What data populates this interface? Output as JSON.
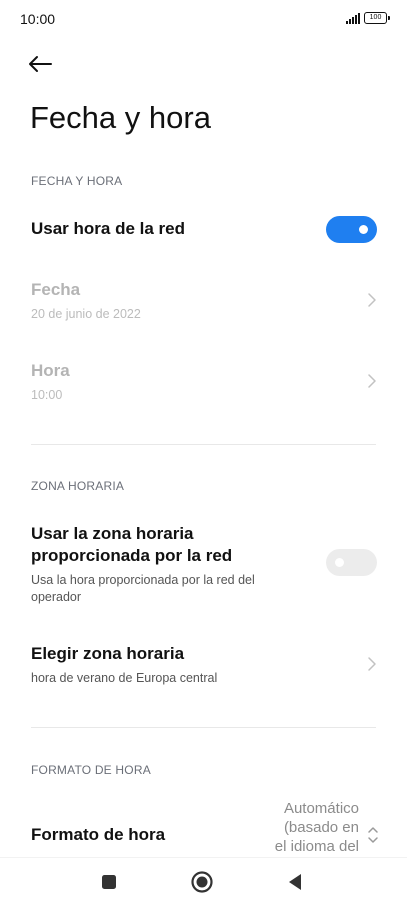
{
  "status_bar": {
    "time": "10:00",
    "battery": "100"
  },
  "page": {
    "title": "Fecha y hora"
  },
  "sections": {
    "date_time": {
      "header": "FECHA Y HORA",
      "network_time": {
        "title": "Usar hora de la red",
        "enabled": true
      },
      "date": {
        "title": "Fecha",
        "value": "20 de junio de 2022"
      },
      "time": {
        "title": "Hora",
        "value": "10:00"
      }
    },
    "time_zone": {
      "header": "ZONA HORARIA",
      "network_zone": {
        "title_line1": "Usar la zona horaria",
        "title_line2": "proporcionada por la red",
        "subtitle_line1": "Usa la hora proporcionada por la red del",
        "subtitle_line2": "operador",
        "enabled": false
      },
      "choose_zone": {
        "title": "Elegir zona horaria",
        "value": "hora de verano de Europa central"
      }
    },
    "time_format": {
      "header": "FORMATO DE HORA",
      "format": {
        "title": "Formato de hora",
        "value_line1": "Automático",
        "value_line2": "(basado en",
        "value_line3": "el idioma del"
      }
    }
  },
  "colors": {
    "accent": "#1f7ff0",
    "toggle_off": "#ececec",
    "disabled_text": "#b4b4b4"
  },
  "icons": {
    "back": "arrow-left-icon",
    "chevron": "chevron-right-icon",
    "updown": "chevron-updown-icon",
    "nav_recents": "square-icon",
    "nav_home": "circle-icon",
    "nav_back": "triangle-left-icon"
  }
}
